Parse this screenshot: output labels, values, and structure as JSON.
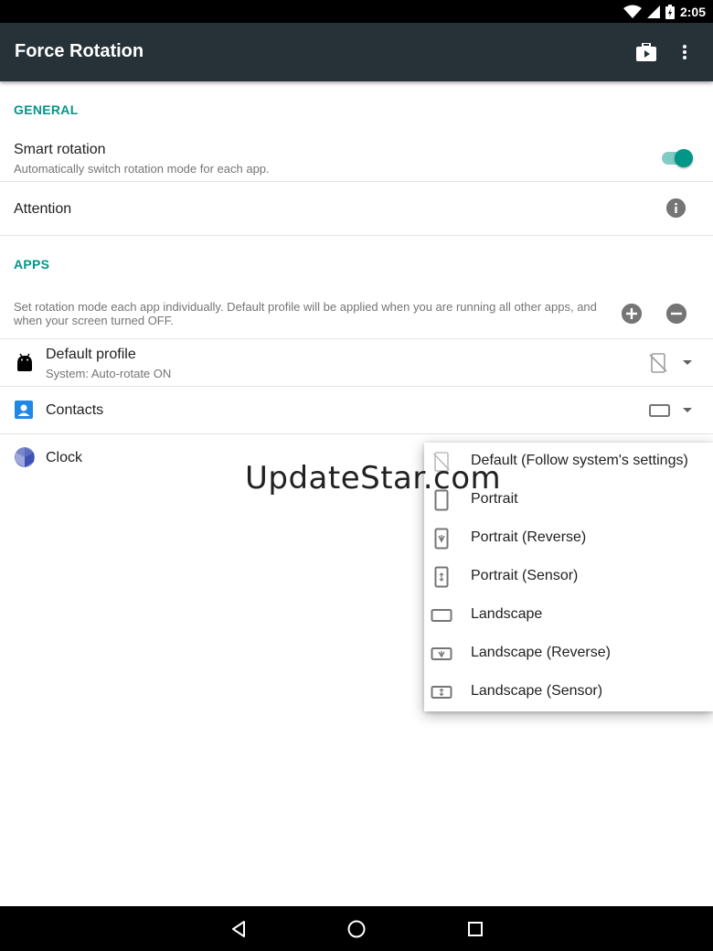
{
  "status_bar": {
    "time": "2:05",
    "icons": [
      "wifi-icon",
      "signal-icon",
      "battery-icon"
    ]
  },
  "app_bar": {
    "title": "Force Rotation",
    "actions": [
      "store-bag-icon",
      "overflow-menu-icon"
    ],
    "background_color": "#263238"
  },
  "general": {
    "header": "GENERAL",
    "smart_rotation": {
      "title": "Smart rotation",
      "subtitle": "Automatically switch rotation mode for each app.",
      "enabled": true
    },
    "attention": {
      "title": "Attention",
      "icon": "info-icon"
    }
  },
  "apps": {
    "header": "APPS",
    "description": "Set rotation mode each app individually. Default profile will be applied when you are running all other apps, and when your screen turned OFF.",
    "add_icon": "plus-circle-icon",
    "remove_icon": "minus-circle-icon",
    "items": [
      {
        "name": "Default profile",
        "subtitle": "System: Auto-rotate ON",
        "icon": "android-icon",
        "mode_icon": "rotation-off-icon"
      },
      {
        "name": "Contacts",
        "subtitle": "",
        "icon": "contacts-icon",
        "mode_icon": "landscape-icon"
      },
      {
        "name": "Clock",
        "subtitle": "",
        "icon": "clock-icon",
        "mode_icon": ""
      }
    ]
  },
  "watermark": "UpdateStar.com",
  "mode_menu": {
    "options": [
      {
        "label": "Default (Follow system's settings)",
        "icon": "rotation-off-icon"
      },
      {
        "label": "Portrait",
        "icon": "portrait-icon"
      },
      {
        "label": "Portrait (Reverse)",
        "icon": "portrait-reverse-icon"
      },
      {
        "label": "Portrait (Sensor)",
        "icon": "portrait-sensor-icon"
      },
      {
        "label": "Landscape",
        "icon": "landscape-icon"
      },
      {
        "label": "Landscape (Reverse)",
        "icon": "landscape-reverse-icon"
      },
      {
        "label": "Landscape (Sensor)",
        "icon": "landscape-sensor-icon"
      }
    ]
  },
  "colors": {
    "accent": "#009688",
    "accent_light": "#80cbc4",
    "icon_gray": "#757575"
  },
  "nav_bar": {
    "buttons": [
      "back-icon",
      "home-icon",
      "recents-icon"
    ]
  }
}
